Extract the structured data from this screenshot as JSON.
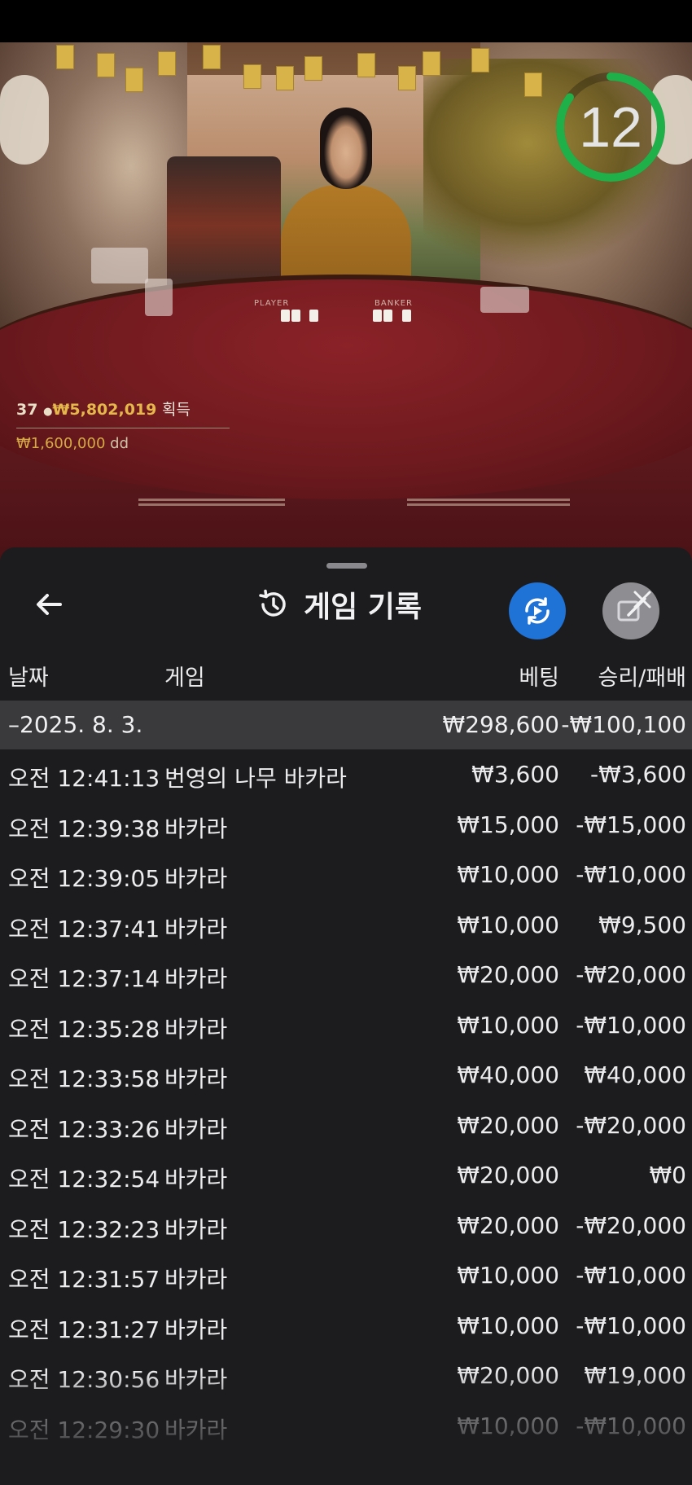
{
  "video": {
    "timer": "12",
    "timer_progress": 0.85,
    "table_labels": {
      "player": "PLAYER",
      "banker": "BANKER"
    },
    "winners": {
      "count": "37",
      "amount": "₩5,802,019",
      "label": "획득"
    },
    "player_win": {
      "amount": "₩1,600,000",
      "name": "dd"
    }
  },
  "panel": {
    "title": "게임 기록",
    "icons": {
      "back": "back-arrow-icon",
      "history": "history-icon",
      "replay": "replay-icon",
      "close": "close-icon"
    },
    "columns": {
      "date": "날짜",
      "game": "게임",
      "bet": "베팅",
      "result": "승리/패배"
    },
    "day": {
      "date": "–2025. 8. 3.",
      "bet": "₩298,600",
      "result": "-₩100,100"
    },
    "rows": [
      {
        "time": "오전 12:41:13",
        "game": "번영의 나무 바카라",
        "bet": "₩3,600",
        "result": "-₩3,600"
      },
      {
        "time": "오전 12:39:38",
        "game": "바카라",
        "bet": "₩15,000",
        "result": "-₩15,000"
      },
      {
        "time": "오전 12:39:05",
        "game": "바카라",
        "bet": "₩10,000",
        "result": "-₩10,000"
      },
      {
        "time": "오전 12:37:41",
        "game": "바카라",
        "bet": "₩10,000",
        "result": "₩9,500"
      },
      {
        "time": "오전 12:37:14",
        "game": "바카라",
        "bet": "₩20,000",
        "result": "-₩20,000"
      },
      {
        "time": "오전 12:35:28",
        "game": "바카라",
        "bet": "₩10,000",
        "result": "-₩10,000"
      },
      {
        "time": "오전 12:33:58",
        "game": "바카라",
        "bet": "₩40,000",
        "result": "₩40,000"
      },
      {
        "time": "오전 12:33:26",
        "game": "바카라",
        "bet": "₩20,000",
        "result": "-₩20,000"
      },
      {
        "time": "오전 12:32:54",
        "game": "바카라",
        "bet": "₩20,000",
        "result": "₩0"
      },
      {
        "time": "오전 12:32:23",
        "game": "바카라",
        "bet": "₩20,000",
        "result": "-₩20,000"
      },
      {
        "time": "오전 12:31:57",
        "game": "바카라",
        "bet": "₩10,000",
        "result": "-₩10,000"
      },
      {
        "time": "오전 12:31:27",
        "game": "바카라",
        "bet": "₩10,000",
        "result": "-₩10,000"
      },
      {
        "time": "오전 12:30:56",
        "game": "바카라",
        "bet": "₩20,000",
        "result": "₩19,000"
      },
      {
        "time": "오전 12:29:30",
        "game": "바카라",
        "bet": "₩10,000",
        "result": "-₩10,000"
      }
    ]
  },
  "colors": {
    "accent_blue": "#1f72d6",
    "timer_green": "#1fb04a",
    "win_gold": "#e6b84c"
  }
}
